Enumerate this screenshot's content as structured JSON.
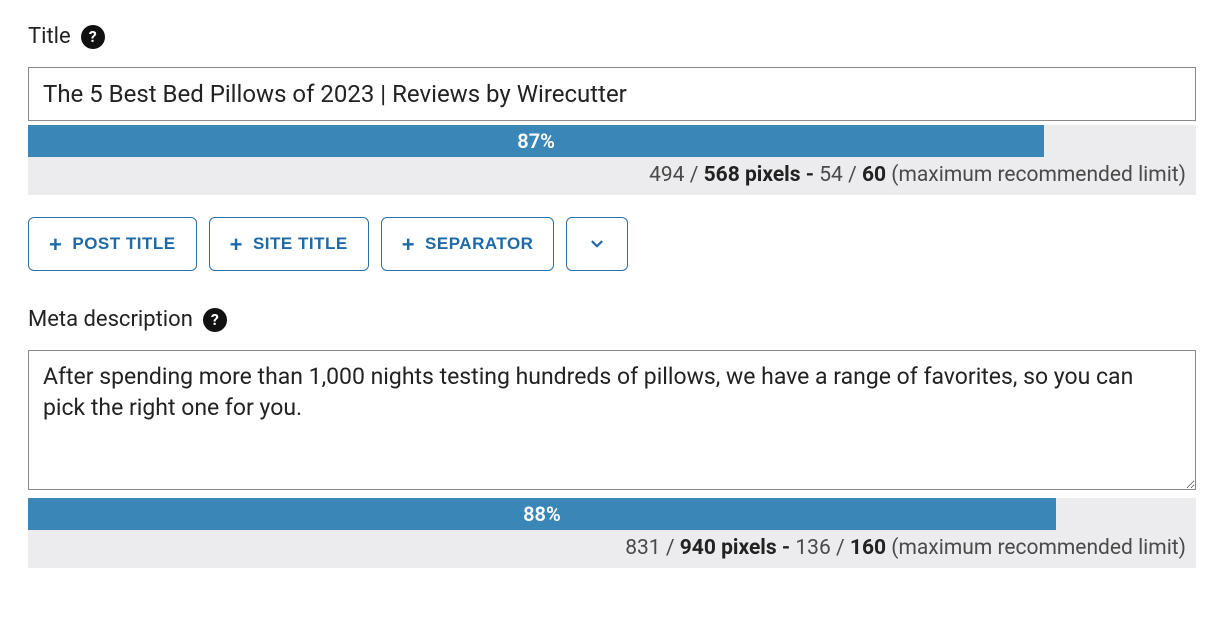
{
  "title_section": {
    "label": "Title",
    "value": "The 5 Best Bed Pillows of 2023 | Reviews by Wirecutter",
    "progress_percent": 87,
    "progress_label": "87%",
    "metrics": {
      "pixels_current": "494",
      "pixels_max": "568",
      "pixels_word": "pixels",
      "chars_current": "54",
      "chars_max": "60",
      "suffix": "(maximum recommended limit)",
      "slash": "/",
      "dash": "-"
    },
    "buttons": {
      "post_title": "POST TITLE",
      "site_title": "SITE TITLE",
      "separator": "SEPARATOR"
    }
  },
  "meta_section": {
    "label": "Meta description",
    "value": "After spending more than 1,000 nights testing hundreds of pillows, we have a range of favorites, so you can pick the right one for you.",
    "progress_percent": 88,
    "progress_label": "88%",
    "metrics": {
      "pixels_current": "831",
      "pixels_max": "940",
      "pixels_word": "pixels",
      "chars_current": "136",
      "chars_max": "160",
      "suffix": "(maximum recommended limit)",
      "slash": "/",
      "dash": "-"
    }
  },
  "help_symbol": "?"
}
